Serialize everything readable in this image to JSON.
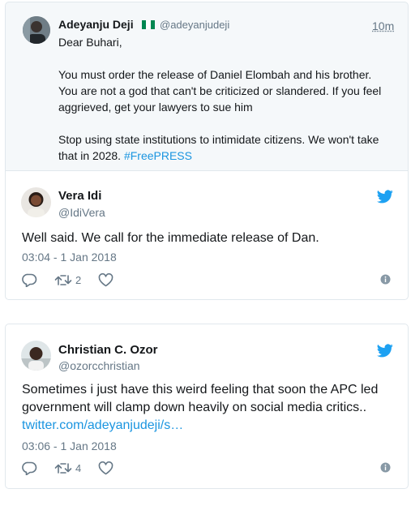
{
  "quoted": {
    "name": "Adeyanju Deji",
    "handle": "@adeyanjudeji",
    "time": "10m",
    "flag_icon": "nigeria-flag-icon",
    "lines": [
      "Dear Buhari,",
      "You must order the release of Daniel Elombah and his brother.",
      "You are not a god that can't be criticized or slandered. If you feel",
      "aggrieved, get your lawyers to sue him",
      "Stop using state institutions to intimidate citizens. We won't take",
      "that in 2028. "
    ],
    "hashtag": "#FreePRESS"
  },
  "tweets": [
    {
      "name": "Vera Idi",
      "handle": "@IdiVera",
      "text": "Well said. We call for the immediate release of Dan.",
      "timestamp": "03:04 - 1 Jan 2018",
      "retweets": "2",
      "icons": [
        "reply-icon",
        "retweet-icon",
        "like-icon",
        "info-icon",
        "twitter-bird-icon"
      ]
    },
    {
      "name": "Christian C. Ozor",
      "handle": "@ozorcchristian",
      "text_line1": "Sometimes i just have this weird feeling that soon the APC led",
      "text_line2": "government will clamp down heavily on social media critics..",
      "link": "twitter.com/adeyanjudeji/s…",
      "timestamp": "03:06 - 1 Jan 2018",
      "retweets": "4",
      "icons": [
        "reply-icon",
        "retweet-icon",
        "like-icon",
        "info-icon",
        "twitter-bird-icon"
      ]
    }
  ],
  "colors": {
    "link": "#1b95e0",
    "twitter_blue": "#1da1f2",
    "muted": "#657786",
    "border": "#e1e8ed",
    "quoted_bg": "#f5f8fa"
  }
}
